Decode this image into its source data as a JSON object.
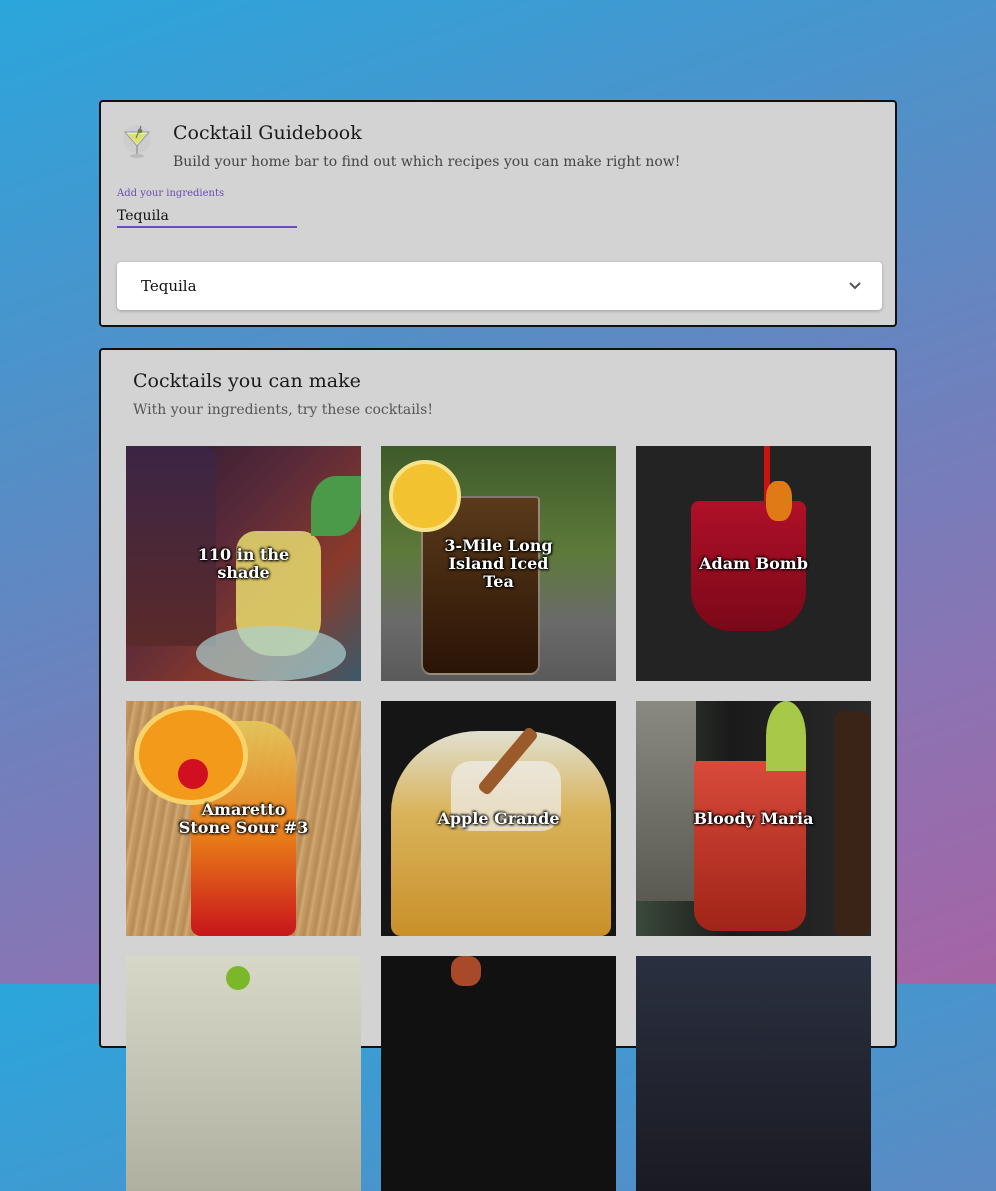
{
  "header": {
    "title": "Cocktail Guidebook",
    "subtitle": "Build your home bar to find out which recipes you can make right now!",
    "app_icon": "martini-glass-icon"
  },
  "ingredient_input": {
    "label": "Add your ingredients",
    "value": "Tequila"
  },
  "ingredient_selector": {
    "selected": "Tequila",
    "icon": "chevron-down-icon"
  },
  "cocktails": {
    "title": "Cocktails you can make",
    "subtitle": "With your ingredients, try these cocktails!",
    "items": [
      {
        "name": "110 in the shade"
      },
      {
        "name": "3-Mile Long Island Iced Tea"
      },
      {
        "name": "Adam Bomb"
      },
      {
        "name": "Amaretto Stone Sour #3"
      },
      {
        "name": "Apple Grande"
      },
      {
        "name": "Bloody Maria"
      },
      {
        "name": ""
      },
      {
        "name": ""
      },
      {
        "name": ""
      }
    ]
  },
  "colors": {
    "accent": "#6a4db8",
    "card_bg": "#d3d3d3"
  }
}
